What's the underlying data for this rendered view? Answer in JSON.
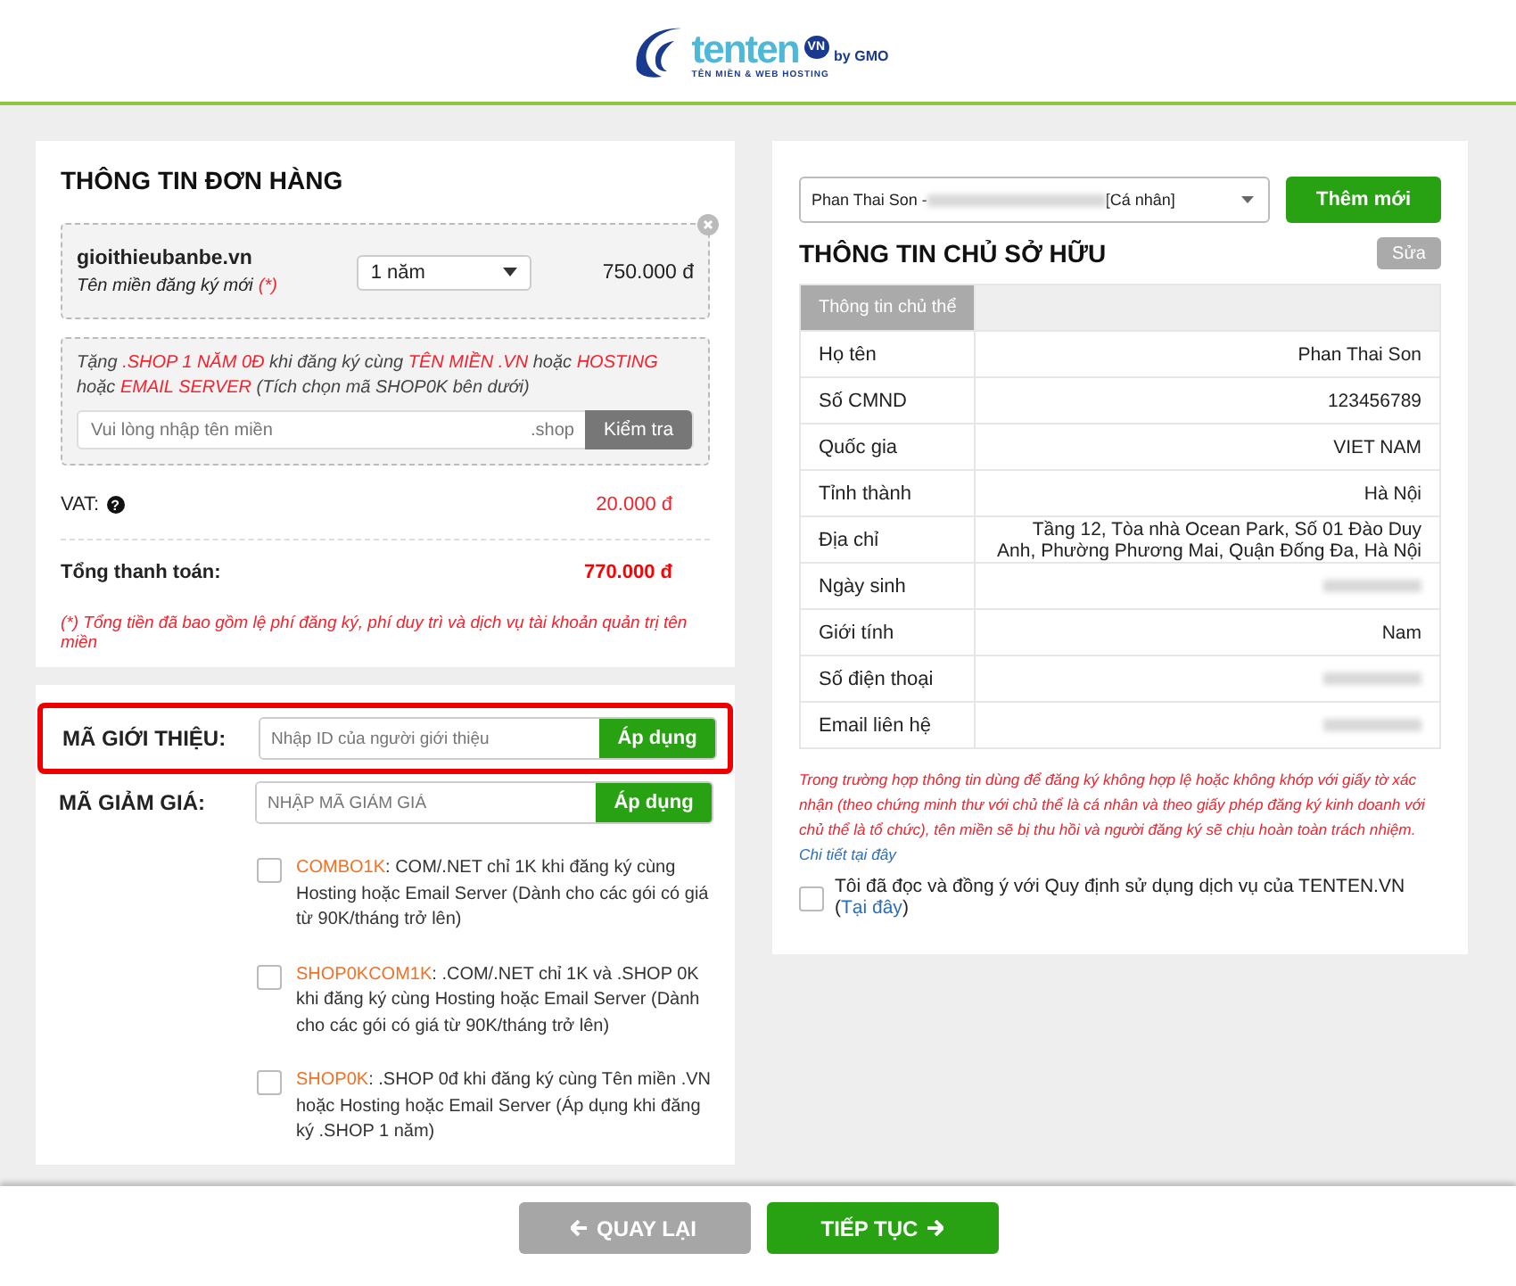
{
  "logo": {
    "brand": "tenten",
    "badge": "VN",
    "by": "by GMO",
    "tagline": "TÊN MIỀN & WEB HOSTING"
  },
  "order": {
    "title": "THÔNG TIN ĐƠN HÀNG",
    "item": {
      "domain": "gioithieubanbe.vn",
      "note": "Tên miền đăng ký mới",
      "mark": "(*)",
      "period": "1 năm",
      "price": "750.000 đ"
    },
    "promo": {
      "segments": [
        {
          "text": "Tặng ",
          "highlight": false
        },
        {
          "text": ".SHOP 1 NĂM 0Đ",
          "highlight": true
        },
        {
          "text": " khi đăng ký cùng ",
          "highlight": false
        },
        {
          "text": "TÊN MIỀN .VN",
          "highlight": true
        },
        {
          "text": " hoặc ",
          "highlight": false
        },
        {
          "text": "HOSTING",
          "highlight": true
        },
        {
          "text": " hoặc ",
          "highlight": false
        },
        {
          "text": "EMAIL SERVER",
          "highlight": true
        },
        {
          "text": " (Tích chọn mã SHOP0K bên dưới)",
          "highlight": false
        }
      ],
      "placeholder": "Vui lòng nhập tên miền",
      "suffix": ".shop",
      "button": "Kiểm tra"
    },
    "vat": {
      "label": "VAT:",
      "icon_glyph": "?",
      "value": "20.000 đ"
    },
    "total": {
      "label": "Tổng thanh toán:",
      "value": "770.000 đ"
    },
    "footnote": "(*) Tổng tiền đã bao gồm lệ phí đăng ký, phí duy trì và dịch vụ tài khoản quản trị tên miền"
  },
  "codes": [
    {
      "label": "MÃ GIỚI THIỆU:",
      "placeholder": "Nhập ID của người giới thiệu",
      "button": "Áp dụng",
      "highlighted": true
    },
    {
      "label": "MÃ GIẢM GIÁ:",
      "placeholder": "NHẬP MÃ GIẢM GIÁ",
      "button": "Áp dụng",
      "highlighted": false
    }
  ],
  "coupons": [
    {
      "code": "COMBO1K",
      "description": ": COM/.NET chỉ 1K khi đăng ký cùng Hosting hoặc Email Server (Dành cho các gói có giá từ 90K/tháng trở lên)",
      "checked": false
    },
    {
      "code": "SHOP0KCOM1K",
      "description": ": .COM/.NET chỉ 1K và .SHOP 0K khi đăng ký cùng Hosting hoặc Email Server (Dành cho các gói có giá từ 90K/tháng trở lên)",
      "checked": false
    },
    {
      "code": "SHOP0K",
      "description": ": .SHOP 0đ khi đăng ký cùng Tên miền .VN hoặc Hosting hoặc Email Server (Áp dụng khi đăng ký .SHOP 1 năm)",
      "checked": false
    }
  ],
  "owner": {
    "select": {
      "name": "Phan Thai Son - ",
      "type": "[Cá nhân]"
    },
    "add_button": "Thêm mới",
    "title": "THÔNG TIN CHỦ SỞ HỮU",
    "edit_button": "Sửa",
    "table": {
      "header": "Thông tin chủ thể",
      "rows": [
        {
          "label": "Họ tên",
          "value": "Phan Thai Son",
          "blurred": false
        },
        {
          "label": "Số CMND",
          "value": "123456789",
          "blurred": false
        },
        {
          "label": "Quốc gia",
          "value": "VIET NAM",
          "blurred": false
        },
        {
          "label": "Tỉnh thành",
          "value": "Hà Nội",
          "blurred": false
        },
        {
          "label": "Địa chỉ",
          "value": "Tầng 12, Tòa nhà Ocean Park, Số 01 Đào Duy Anh, Phường Phương Mai, Quận Đống Đa, Hà Nội",
          "blurred": false
        },
        {
          "label": "Ngày sinh",
          "blurred": true
        },
        {
          "label": "Giới tính",
          "value": "Nam",
          "blurred": false
        },
        {
          "label": "Số điện thoại",
          "blurred": true
        },
        {
          "label": "Email liên hệ",
          "blurred": true
        }
      ]
    },
    "warning": "Trong trường hợp thông tin dùng để đăng ký không hợp lệ hoặc không khớp với giấy tờ xác nhận (theo chứng minh thư với chủ thể là cá nhân và theo giấy phép đăng ký kinh doanh với chủ thể là tổ chức), tên miền sẽ bị thu hồi và người đăng ký sẽ chịu hoàn toàn trách nhiệm.",
    "warning_link": "Chi tiết tại đây",
    "agree": {
      "text": "Tôi đã đọc và đồng ý với Quy định sử dụng dịch vụ của TENTEN.VN (",
      "link": "Tại đây",
      "suffix": ")",
      "checked": false
    }
  },
  "footer": {
    "back": "QUAY LẠI",
    "next": "TIẾP TỤC"
  }
}
